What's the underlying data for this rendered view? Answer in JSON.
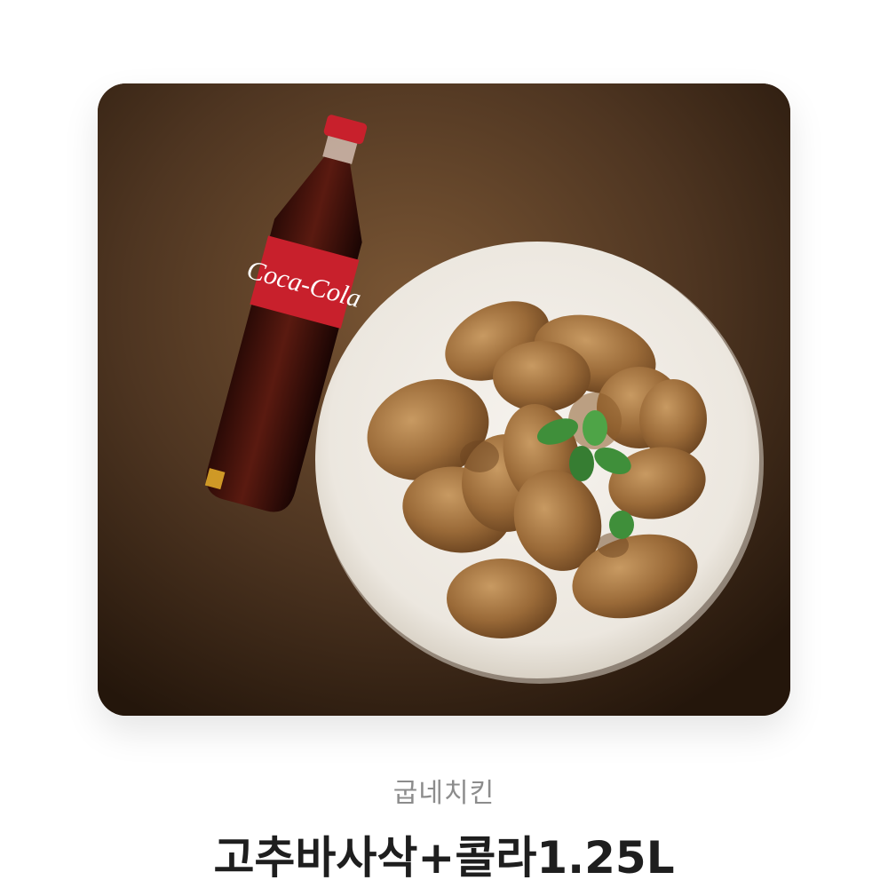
{
  "product": {
    "brand": "굽네치킨",
    "title": "고추바사삭+콜라1.25L",
    "image_logo_text": "Coca-Cola"
  },
  "colors": {
    "background": "#ffffff",
    "table_brown": "#4a3320",
    "plate": "#f2efe9",
    "chicken": "#9a6a38",
    "cola_red": "#c8202c",
    "mint": "#3f8f3a",
    "brand_text": "#8c8c8c",
    "title_text": "#1e1e1e"
  }
}
